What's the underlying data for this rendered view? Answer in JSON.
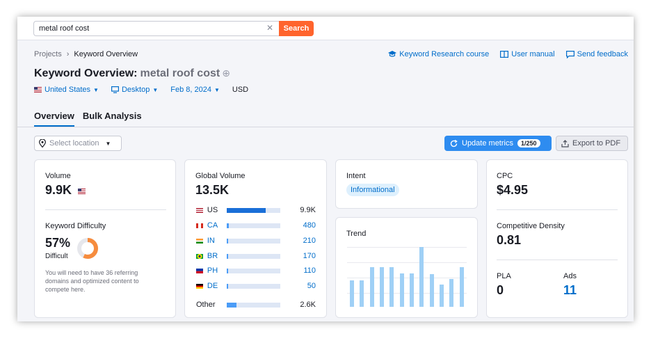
{
  "search": {
    "value": "metal roof cost",
    "button": "Search"
  },
  "breadcrumb": {
    "root": "Projects",
    "current": "Keyword Overview"
  },
  "links": {
    "course": "Keyword Research course",
    "manual": "User manual",
    "feedback": "Send feedback"
  },
  "title": {
    "label": "Keyword Overview:",
    "keyword": "metal roof cost"
  },
  "filters": {
    "country": "United States",
    "device": "Desktop",
    "date": "Feb 8, 2024",
    "currency": "USD"
  },
  "tabs": [
    "Overview",
    "Bulk Analysis"
  ],
  "toolbar": {
    "location_placeholder": "Select location",
    "update": "Update metrics",
    "update_count": "1/250",
    "export": "Export to PDF"
  },
  "volume": {
    "label": "Volume",
    "value": "9.9K"
  },
  "difficulty": {
    "label": "Keyword Difficulty",
    "value": "57%",
    "level": "Difficult",
    "percent": 57,
    "note": "You will need to have 36 referring domains and optimized content to compete here."
  },
  "global": {
    "label": "Global Volume",
    "value": "13.5K",
    "rows": [
      {
        "code": "US",
        "value": "9.9K",
        "share": 0.73
      },
      {
        "code": "CA",
        "value": "480",
        "share": 0.04
      },
      {
        "code": "IN",
        "value": "210",
        "share": 0.02
      },
      {
        "code": "BR",
        "value": "170",
        "share": 0.02
      },
      {
        "code": "PH",
        "value": "110",
        "share": 0.01
      },
      {
        "code": "DE",
        "value": "50",
        "share": 0.01
      }
    ],
    "other": {
      "code": "Other",
      "value": "2.6K",
      "share": 0.19
    }
  },
  "intent": {
    "label": "Intent",
    "value": "Informational"
  },
  "trend": {
    "label": "Trend",
    "values": [
      0.44,
      0.44,
      0.66,
      0.66,
      0.66,
      0.56,
      0.56,
      1.0,
      0.55,
      0.37,
      0.46,
      0.66
    ]
  },
  "cpc": {
    "label": "CPC",
    "value": "$4.95"
  },
  "density": {
    "label": "Competitive Density",
    "value": "0.81"
  },
  "pla": {
    "label": "PLA",
    "value": "0"
  },
  "ads": {
    "label": "Ads",
    "value": "11"
  },
  "colors": {
    "accent": "#006dca",
    "search": "#ff642d",
    "update": "#2e8cf0",
    "difficulty": "#f68c3e"
  }
}
